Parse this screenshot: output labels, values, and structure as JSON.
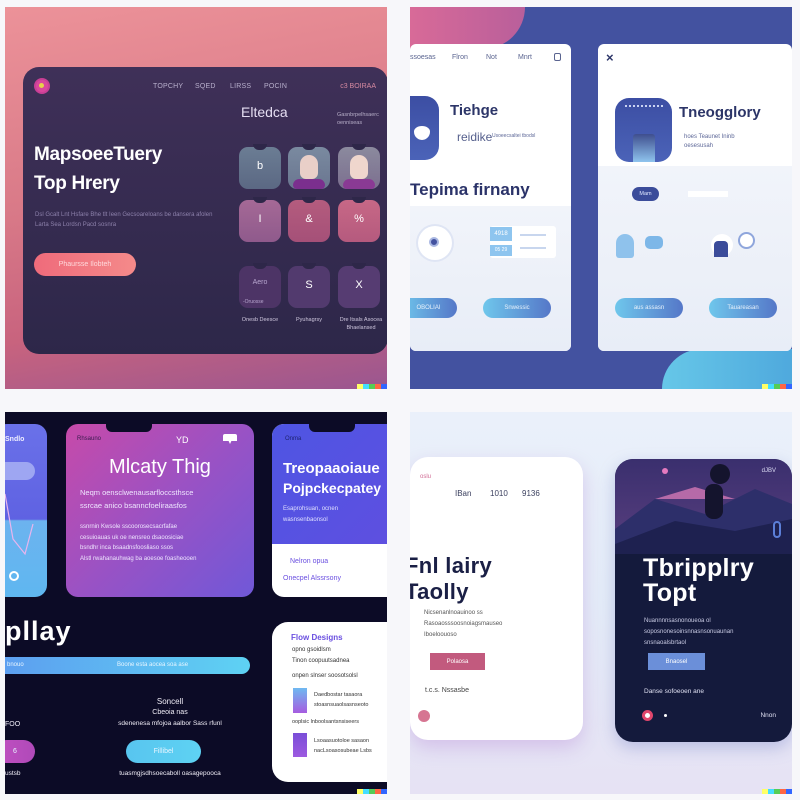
{
  "panel1": {
    "nav": [
      "TOPCHY",
      "SQED",
      "LIRSS",
      "POCIN"
    ],
    "nav_cta": "c3 BOIRAA",
    "headline_line1": "MapsoeeTuery",
    "headline_line2": "Top Hrery",
    "body": "Dsl Gcalt Lnt Hsfare Bhe tlt Ieen Gecsoareloans be dansera afolen Larta Sea Lordsn Pacd sosnra",
    "cta_button": "Phaursse Ilobteh",
    "section_title": "Eltedca",
    "section_subtitle": "Gasnbrpelhsaerc oenniseas",
    "tile_glyphs": [
      "b",
      "",
      "",
      "I",
      "&",
      "%",
      "Aero",
      "S",
      "X"
    ],
    "tile_caption_first": "-Oruosse",
    "captions": [
      "Onesb Deesce",
      "Pyuhagrsy",
      "Dre ltsals Asocea Bhaelansed"
    ],
    "colors": {
      "accent": "#ef6b7b",
      "card": "#2d2749"
    }
  },
  "panel2": {
    "left": {
      "nav": [
        "ssoesas",
        "Flron",
        "Not",
        "Mnrt"
      ],
      "title": "Tiehge",
      "subtitle_big": "reidike",
      "subtitle_small": "Usoeecsaltei tbodsl",
      "headline": "Tepima firnany",
      "widget_value_1": "4918",
      "widget_value_2": "05 29",
      "button_1": "OBOLIAI",
      "button_2": "Snwessic"
    },
    "right": {
      "close_label": "×",
      "title": "Tneogglory",
      "description_line1": "hoes Teaunet Ininb",
      "description_line2": "oesesusah",
      "toggle_label": "Mam",
      "button_1": "aus assasn",
      "button_2": "Tauareasan"
    },
    "colors": {
      "primary": "#4352a0",
      "button_start": "#6fc7ec",
      "button_end": "#5577c8"
    }
  },
  "panel3": {
    "left_card": {
      "label": "Sndlo"
    },
    "center_card": {
      "label": "Rhsauno",
      "badge": "YD",
      "title": "Mlcaty Thig",
      "body_lines": [
        "Neqm oensclwenausarfloccsthsce",
        "ssrcae anico bsanncfoeliraasfos",
        "ssnrnin Kwsole sscoorosecsacrfafae",
        "cesuioauas uk oe nensreo dsaoosiciae",
        "bsndhr inca bsaadnsfoosliaso ssos",
        "Alstl rwahanauhwag ba aoesoe foasheooen"
      ]
    },
    "right_card": {
      "label": "Onma",
      "title_line1": "Treopaaoiaue",
      "title_line2": "Pojpckecpatey",
      "body": "Esaprohsuan, ocnen wasnsenbaonsol",
      "link_1": "Nelron opua",
      "link_2": "Onecpel Alssrsony"
    },
    "headline": "pllay",
    "bar_left": "bnouo",
    "bar_text": "Boone esta aocea soa ase",
    "center_title": "Soncell",
    "center_subtitle": "Cbeoia nas",
    "center_body": "sdenenesa mfojoa aalbor Sass rfunl",
    "left_value": "FOO",
    "left_button": "6",
    "center_button": "Fillibel",
    "footer_left": "ustsb",
    "footer_center": "tuasmgjsdhsoecaboll oasagepooca",
    "info_card": {
      "title": "Flow Designs",
      "line1": "opno gsoidlsm",
      "line2": "Tinon coopuutsadnea",
      "line3": "onpen slnser soosotsolsl",
      "item1_line1": "Daedbostar tasaora",
      "item1_line2": "stoasnsuaolsasnseoto",
      "mid_line": "ooplsic lnboolsantsnsiseers",
      "item2_line1": "Lsoaasuotoloe sasaon",
      "item2_line2": "nacLsoasosubeae Lsbs"
    },
    "colors": {
      "bg": "#0c0b26",
      "gradient_pink": "#c548a8",
      "gradient_violet": "#6b5bd9",
      "cyan": "#5ed2f3"
    }
  },
  "panel4": {
    "light_card": {
      "tag": "oslu",
      "stats": [
        "IBan",
        "1010",
        "9136"
      ],
      "headline_line1": "Fnl lairy",
      "headline_line2": "Taolly",
      "body_lines": [
        "Nicsenanlnoauinoo ss",
        "Rasoaosssoosnoiagsmauseo",
        "Iboeloouoso"
      ],
      "button": "Polaosa",
      "meta": "t.c.s. Nssasbe"
    },
    "dark_card": {
      "tag": "dJBV",
      "headline_line1": "Tbripplry",
      "headline_line2": "Topt",
      "body_lines": [
        "Nuannnnsasnonoueoa ol",
        "soposnonesoinsnnasnsonuaunan",
        "snsnaoalsbrtaol"
      ],
      "button": "Bnaosel",
      "meta": "Danse sofoeoen ane",
      "footer_label": "Nnon"
    },
    "colors": {
      "ink": "#1a1f45",
      "button_pink": "#c25a7e",
      "button_blue": "#6b8fd9",
      "dark_card": "#141a3c"
    }
  }
}
